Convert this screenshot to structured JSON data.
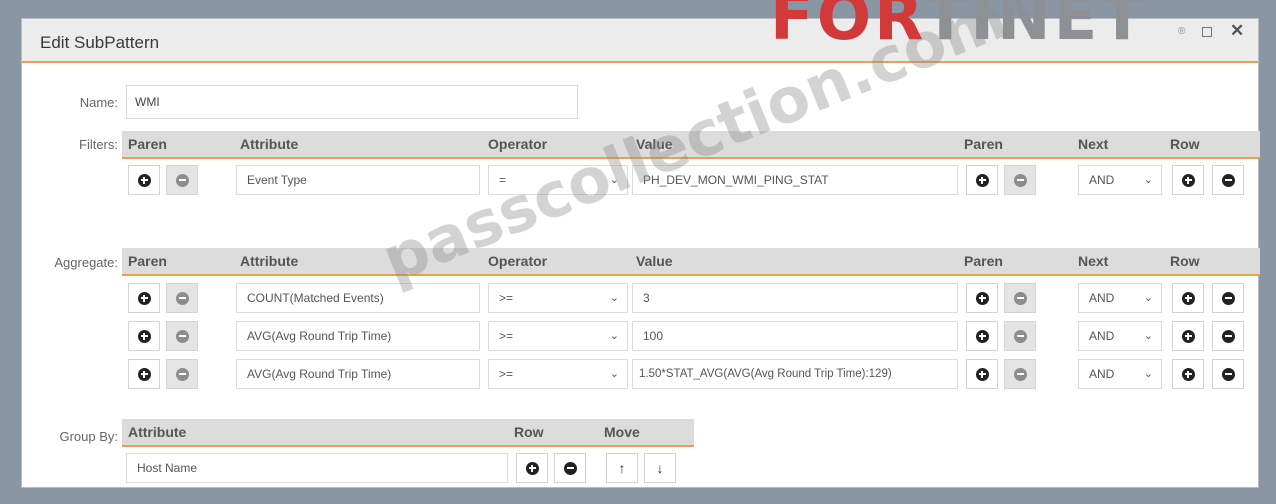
{
  "dialog": {
    "title": "Edit SubPattern"
  },
  "brand": {
    "logo_text_red": "FOR",
    "logo_text_rest": "TINET",
    "reg": "®"
  },
  "labels": {
    "name": "Name:",
    "filters": "Filters:",
    "aggregate": "Aggregate:",
    "group_by": "Group By:"
  },
  "name_value": "WMI",
  "columns": {
    "paren": "Paren",
    "attribute": "Attribute",
    "operator": "Operator",
    "value": "Value",
    "paren2": "Paren",
    "next": "Next",
    "row": "Row",
    "move": "Move"
  },
  "filters": [
    {
      "attribute": "Event Type",
      "operator": "=",
      "value": "PH_DEV_MON_WMI_PING_STAT",
      "next": "AND"
    }
  ],
  "aggregate": [
    {
      "attribute": "COUNT(Matched Events)",
      "operator": ">=",
      "value": "3",
      "next": "AND"
    },
    {
      "attribute": "AVG(Avg Round Trip Time)",
      "operator": ">=",
      "value": "100",
      "next": "AND"
    },
    {
      "attribute": "AVG(Avg Round Trip Time)",
      "operator": ">=",
      "value": "1.50*STAT_AVG(AVG(Avg Round Trip Time):129)",
      "next": "AND"
    }
  ],
  "group_by": [
    {
      "attribute": "Host Name"
    }
  ],
  "watermark": "passcollection.com",
  "colors": {
    "accent": "#f0a040",
    "header_bg": "#dcdcdc"
  }
}
